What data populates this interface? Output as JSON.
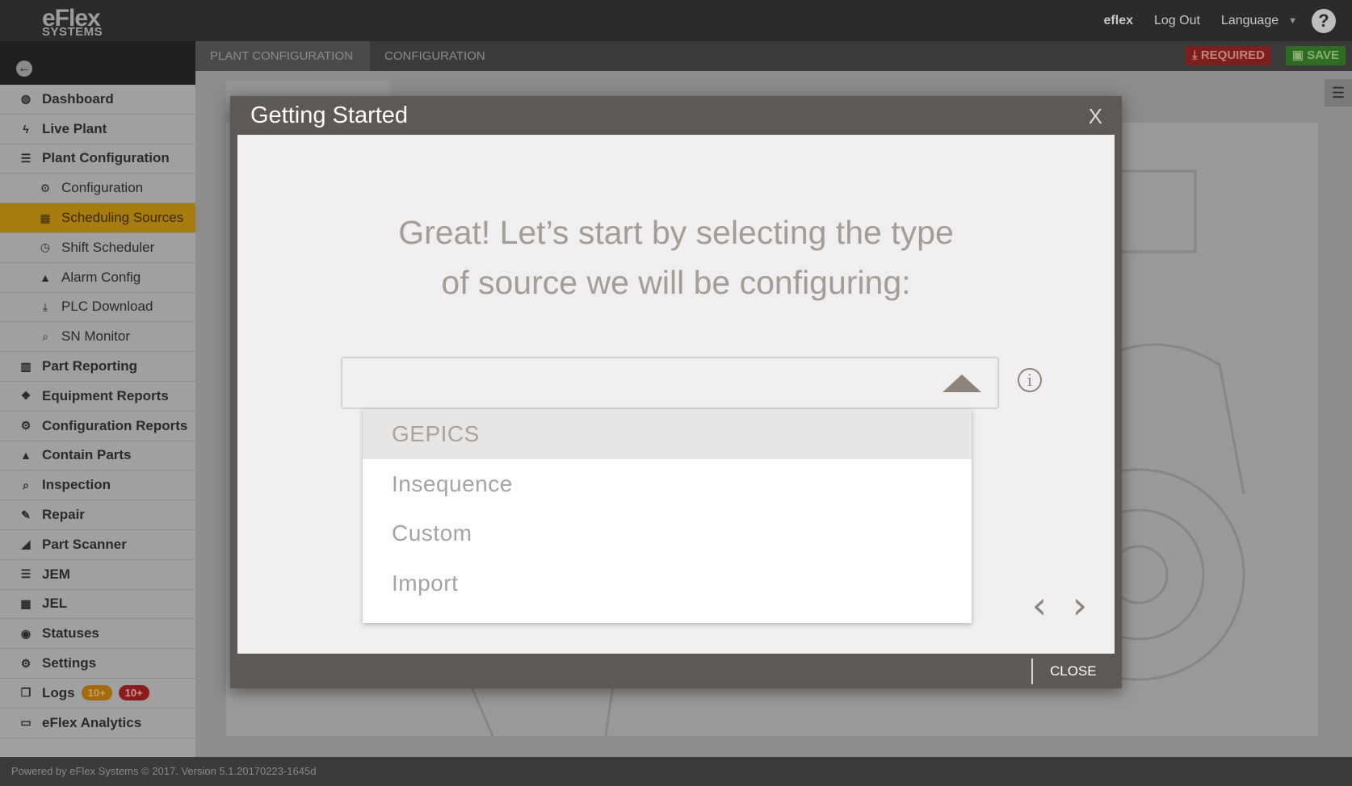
{
  "header": {
    "logo_line1": "eFlex",
    "logo_line2": "SYSTEMS",
    "user": "eflex",
    "logout": "Log Out",
    "language": "Language",
    "help": "?"
  },
  "tabs": {
    "plant_configuration": "PLANT CONFIGURATION",
    "configuration": "CONFIGURATION"
  },
  "actions": {
    "required": "REQUIRED",
    "save": "SAVE"
  },
  "sidebar": {
    "items": [
      {
        "label": "Dashboard",
        "icon": "dashboard-icon",
        "glyph": "◍"
      },
      {
        "label": "Live Plant",
        "icon": "bolt-icon",
        "glyph": "ϟ"
      },
      {
        "label": "Plant Configuration",
        "icon": "sliders-icon",
        "glyph": "☰"
      },
      {
        "label": "Configuration",
        "icon": "gear-icon",
        "glyph": "⚙"
      },
      {
        "label": "Scheduling Sources",
        "icon": "calendar-icon",
        "glyph": "▦"
      },
      {
        "label": "Shift Scheduler",
        "icon": "clock-icon",
        "glyph": "◷"
      },
      {
        "label": "Alarm Config",
        "icon": "warning-icon",
        "glyph": "▲"
      },
      {
        "label": "PLC Download",
        "icon": "download-icon",
        "glyph": "⤓"
      },
      {
        "label": "SN Monitor",
        "icon": "search-icon",
        "glyph": "⌕"
      },
      {
        "label": "Part Reporting",
        "icon": "bar-chart-icon",
        "glyph": "▥"
      },
      {
        "label": "Equipment Reports",
        "icon": "cubes-icon",
        "glyph": "❖"
      },
      {
        "label": "Configuration Reports",
        "icon": "gear-icon",
        "glyph": "⚙"
      },
      {
        "label": "Contain Parts",
        "icon": "warning-icon",
        "glyph": "▲"
      },
      {
        "label": "Inspection",
        "icon": "search-icon",
        "glyph": "⌕"
      },
      {
        "label": "Repair",
        "icon": "wrench-icon",
        "glyph": "✎"
      },
      {
        "label": "Part Scanner",
        "icon": "scanner-icon",
        "glyph": "◢"
      },
      {
        "label": "JEM",
        "icon": "list-icon",
        "glyph": "☰"
      },
      {
        "label": "JEL",
        "icon": "grid-icon",
        "glyph": "▦"
      },
      {
        "label": "Statuses",
        "icon": "circle-dot-icon",
        "glyph": "◉"
      },
      {
        "label": "Settings",
        "icon": "gear-icon",
        "glyph": "⚙"
      },
      {
        "label": "Logs",
        "icon": "files-icon",
        "glyph": "❐",
        "badge1": "10+",
        "badge2": "10+"
      },
      {
        "label": "eFlex Analytics",
        "icon": "monitor-icon",
        "glyph": "▭"
      }
    ]
  },
  "modal": {
    "title": "Getting Started",
    "close_x": "X",
    "prompt_line1": "Great! Let’s start by selecting the type",
    "prompt_line2": "of source we will be configuring:",
    "options": [
      "GEPICS",
      "Insequence",
      "Custom",
      "Import"
    ],
    "selected_option": "GEPICS",
    "info": "i",
    "prev": "‹",
    "next": "›",
    "close": "CLOSE"
  },
  "footer": {
    "text": "Powered by eFlex Systems © 2017.  Version 5.1.20170223-1645d"
  },
  "colors": {
    "active_nav": "#a67c0f",
    "required": "#7a1e1e",
    "save": "#2f6b22",
    "modal_header": "#5f5955",
    "prompt_text": "#a39d97"
  }
}
